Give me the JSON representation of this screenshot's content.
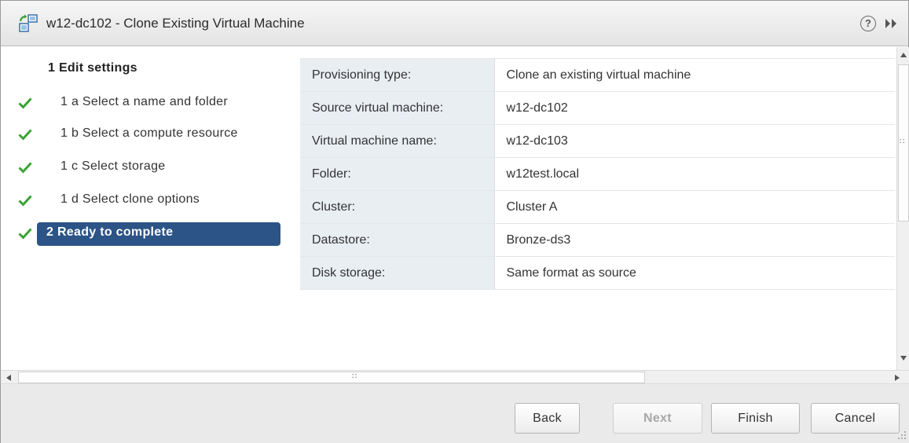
{
  "window": {
    "title": "w12-dc102 - Clone Existing Virtual Machine",
    "icon": "clone-vm-icon",
    "help_icon_glyph": "?"
  },
  "nav": {
    "items": [
      {
        "label": "1 Edit settings",
        "checked": false,
        "heading": true,
        "active": false
      },
      {
        "label": "1 a  Select a name and folder",
        "checked": true,
        "heading": false,
        "active": false
      },
      {
        "label": "1 b  Select a compute resource",
        "checked": true,
        "heading": false,
        "active": false
      },
      {
        "label": "1 c  Select storage",
        "checked": true,
        "heading": false,
        "active": false
      },
      {
        "label": "1 d  Select clone options",
        "checked": true,
        "heading": false,
        "active": false
      },
      {
        "label": "2 Ready to complete",
        "checked": true,
        "heading": true,
        "active": true
      }
    ]
  },
  "summary": {
    "rows": [
      {
        "key": "Provisioning type:",
        "value": "Clone an existing virtual machine"
      },
      {
        "key": "Source virtual machine:",
        "value": "w12-dc102"
      },
      {
        "key": "Virtual machine name:",
        "value": "w12-dc103"
      },
      {
        "key": "Folder:",
        "value": "w12test.local"
      },
      {
        "key": "Cluster:",
        "value": "Cluster A"
      },
      {
        "key": "Datastore:",
        "value": "Bronze-ds3"
      },
      {
        "key": "Disk storage:",
        "value": "Same format as source"
      }
    ]
  },
  "footer": {
    "back_label": "Back",
    "next_label": "Next",
    "finish_label": "Finish",
    "cancel_label": "Cancel",
    "next_disabled": true
  },
  "colors": {
    "active_step": "#2c5486",
    "check": "#3aa335",
    "key_column": "#e9eef3"
  }
}
